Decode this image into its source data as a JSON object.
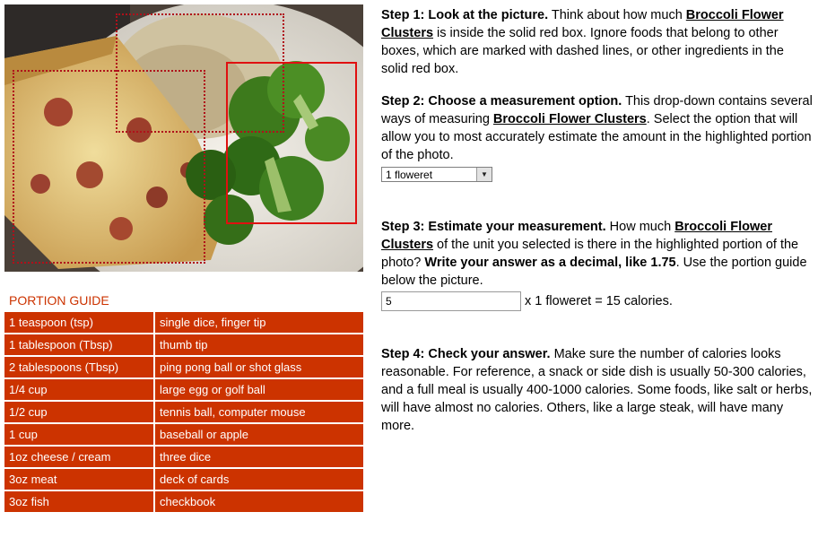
{
  "food_name": "Broccoli Flower Clusters",
  "photo": {
    "image_name": "food-photo"
  },
  "portion_guide": {
    "title": "PORTION GUIDE",
    "rows": [
      {
        "measure": "1 teaspoon (tsp)",
        "comparison": "single dice, finger tip"
      },
      {
        "measure": "1 tablespoon (Tbsp)",
        "comparison": "thumb tip"
      },
      {
        "measure": "2 tablespoons (Tbsp)",
        "comparison": "ping pong ball or shot glass"
      },
      {
        "measure": "1/4 cup",
        "comparison": "large egg or golf ball"
      },
      {
        "measure": "1/2 cup",
        "comparison": "tennis ball, computer mouse"
      },
      {
        "measure": "1 cup",
        "comparison": "baseball or apple"
      },
      {
        "measure": "1oz cheese / cream",
        "comparison": "three dice"
      },
      {
        "measure": "3oz meat",
        "comparison": "deck of cards"
      },
      {
        "measure": "3oz fish",
        "comparison": "checkbook"
      }
    ]
  },
  "step1": {
    "heading": "Step 1: Look at the picture.",
    "text_a": " Think about how much ",
    "food": "Broccoli Flower Clusters",
    "text_b": " is inside the solid red box. Ignore foods that belong to other boxes, which are marked with dashed lines, or other ingredients in the solid red box."
  },
  "step2": {
    "heading": "Step 2: Choose a measurement option.",
    "text_a": " This drop-down contains several ways of measuring ",
    "food": "Broccoli Flower Clusters",
    "text_b": ". Select the option that will allow you to most accurately estimate the amount in the highlighted portion of the photo.",
    "select_value": "1 floweret"
  },
  "step3": {
    "heading": "Step 3: Estimate your measurement.",
    "text_a": " How much ",
    "food": "Broccoli Flower Clusters",
    "text_b": " of the unit you selected is there in the highlighted portion of the photo? ",
    "bold_instruction": "Write your answer as a decimal, like 1.75",
    "text_c": ". Use the portion guide below the picture.",
    "amount_value": "5",
    "calorie_text": " x 1 floweret = 15 calories."
  },
  "step4": {
    "heading": "Step 4: Check your answer.",
    "text": " Make sure the number of calories looks reasonable. For reference, a snack or side dish is usually 50-300 calories, and a full meal is usually 400-1000 calories. Some foods, like salt or herbs, will have almost no calories. Others, like a large steak, will have many more."
  },
  "colors": {
    "guide_bg": "#cc3300",
    "guide_title": "#cc3300",
    "solid_box": "#e01010",
    "dashed_box": "#b0101a"
  }
}
